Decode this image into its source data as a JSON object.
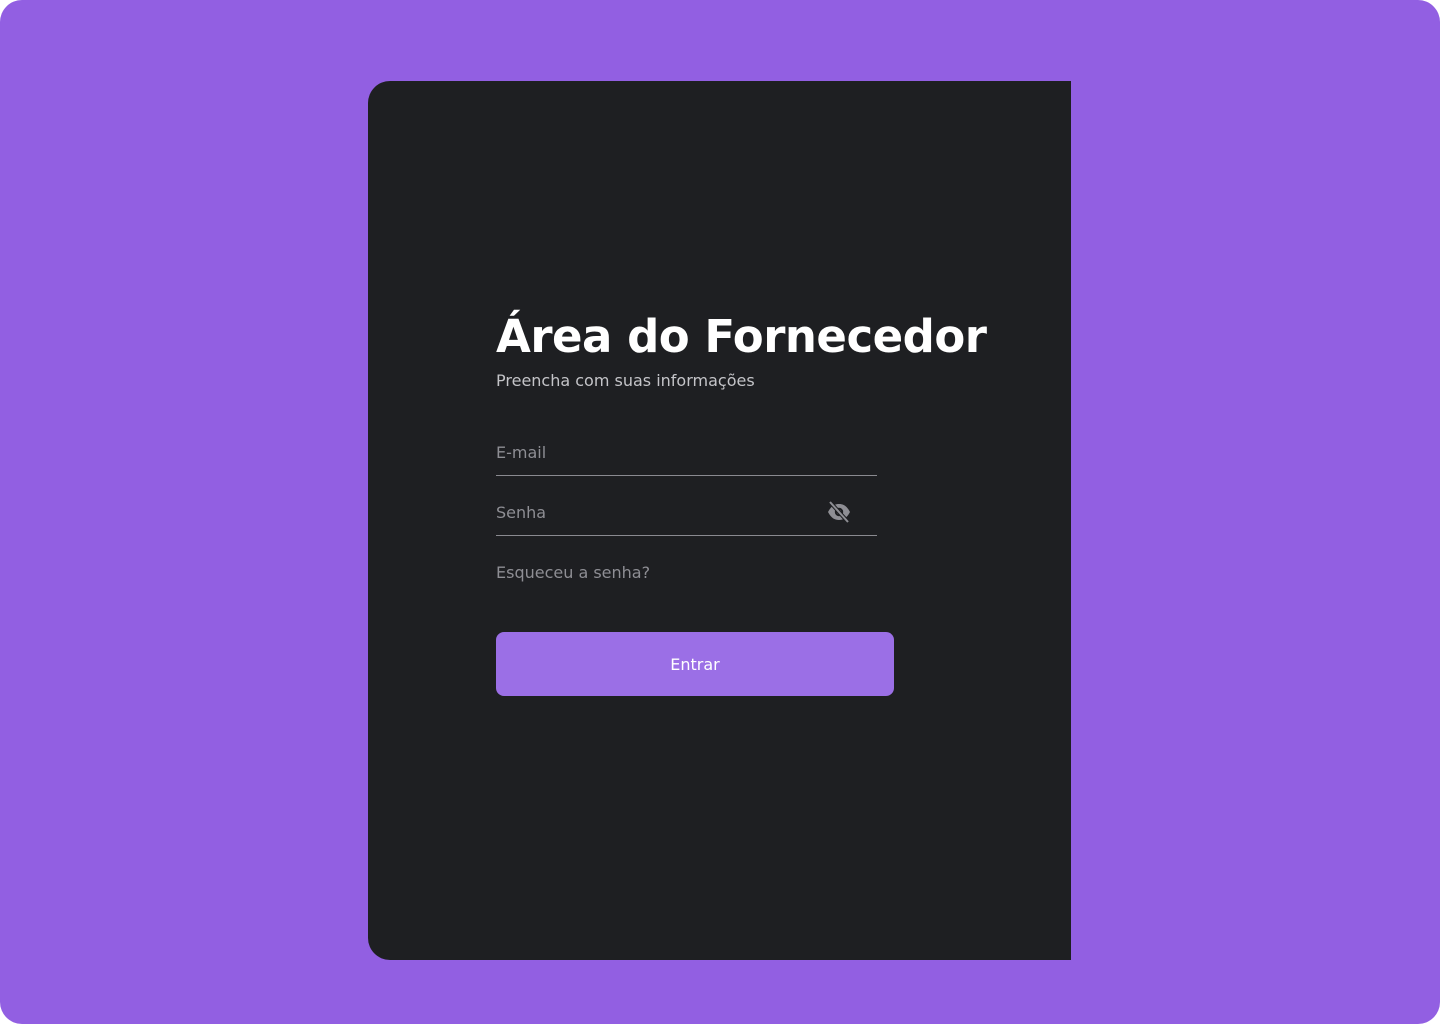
{
  "colors": {
    "background": "#925fe2",
    "card": "#1e1f22",
    "button": "#9b6fe6",
    "text_primary": "#ffffff",
    "text_muted": "#8e8e94"
  },
  "login": {
    "title": "Área do Fornecedor",
    "subtitle": "Preencha com suas informações",
    "email": {
      "value": "",
      "placeholder": "E-mail"
    },
    "password": {
      "value": "",
      "placeholder": "Senha",
      "toggle_icon": "eye-off-icon"
    },
    "forgot_password": "Esqueceu a senha?",
    "submit_label": "Entrar"
  }
}
